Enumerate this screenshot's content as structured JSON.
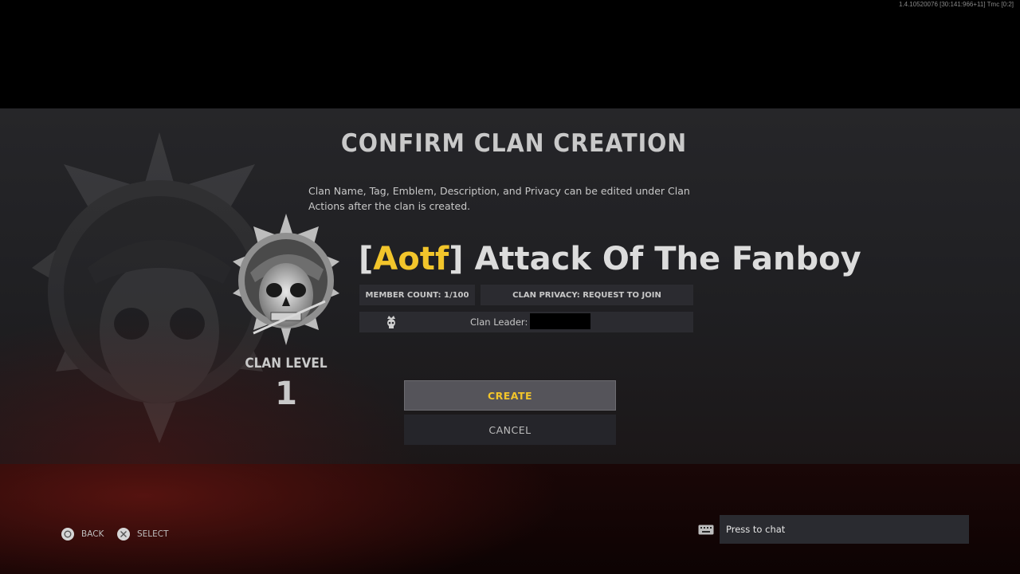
{
  "build_info": "1.4.10520076 [30:141:966+11] Tmc [0:2]",
  "dialog": {
    "title": "CONFIRM CLAN CREATION",
    "info_text": "Clan Name, Tag, Emblem, Description, and Privacy can be edited under Clan Actions after the clan is created."
  },
  "clan": {
    "tag_open": "[",
    "tag": "Aotf",
    "tag_close": "]",
    "name": " Attack Of The Fanboy",
    "level_label": "CLAN LEVEL",
    "level": "1",
    "member_count": "MEMBER COUNT: 1/100",
    "privacy": "CLAN PRIVACY: REQUEST TO JOIN",
    "leader_label": "Clan Leader:"
  },
  "buttons": {
    "create": "CREATE",
    "cancel": "CANCEL"
  },
  "footer": {
    "back": "BACK",
    "select": "SELECT",
    "chat_placeholder": "Press to chat"
  },
  "colors": {
    "accent": "#f2c52b",
    "panel": "#2b2b30"
  },
  "icons": {
    "emblem": "skull-beret-emblem-icon",
    "leader": "skull-crown-icon",
    "back": "circle-button-icon",
    "select": "cross-button-icon",
    "chat": "keyboard-icon"
  }
}
